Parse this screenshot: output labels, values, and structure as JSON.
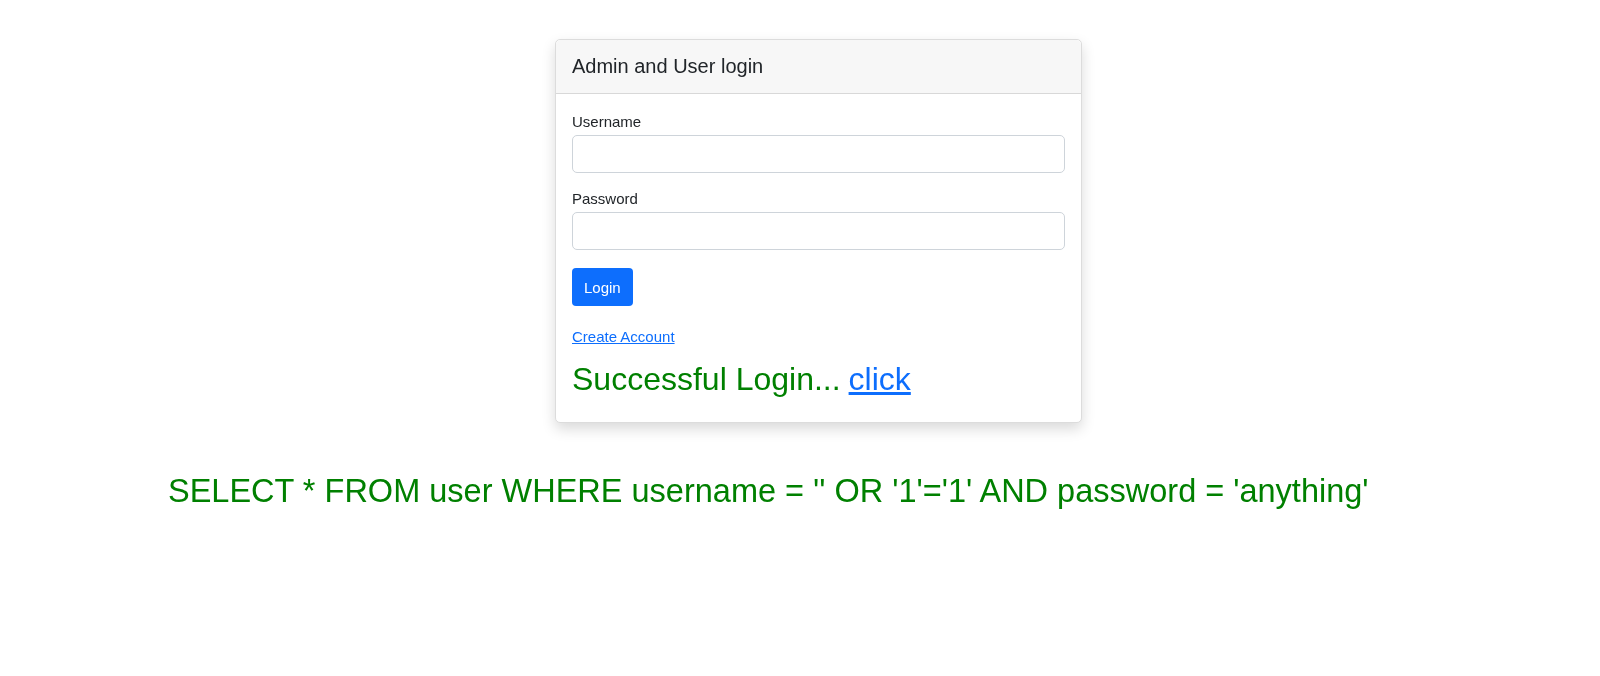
{
  "card": {
    "title": "Admin and User login",
    "fields": [
      {
        "label": "Username"
      },
      {
        "label": "Password"
      }
    ],
    "button": "Login",
    "link": "Create Account",
    "message": {
      "text": "Successful Login...",
      "link": "click"
    }
  },
  "query": "SELECT * FROM user WHERE username = '' OR '1'='1' AND password = 'anything'"
}
